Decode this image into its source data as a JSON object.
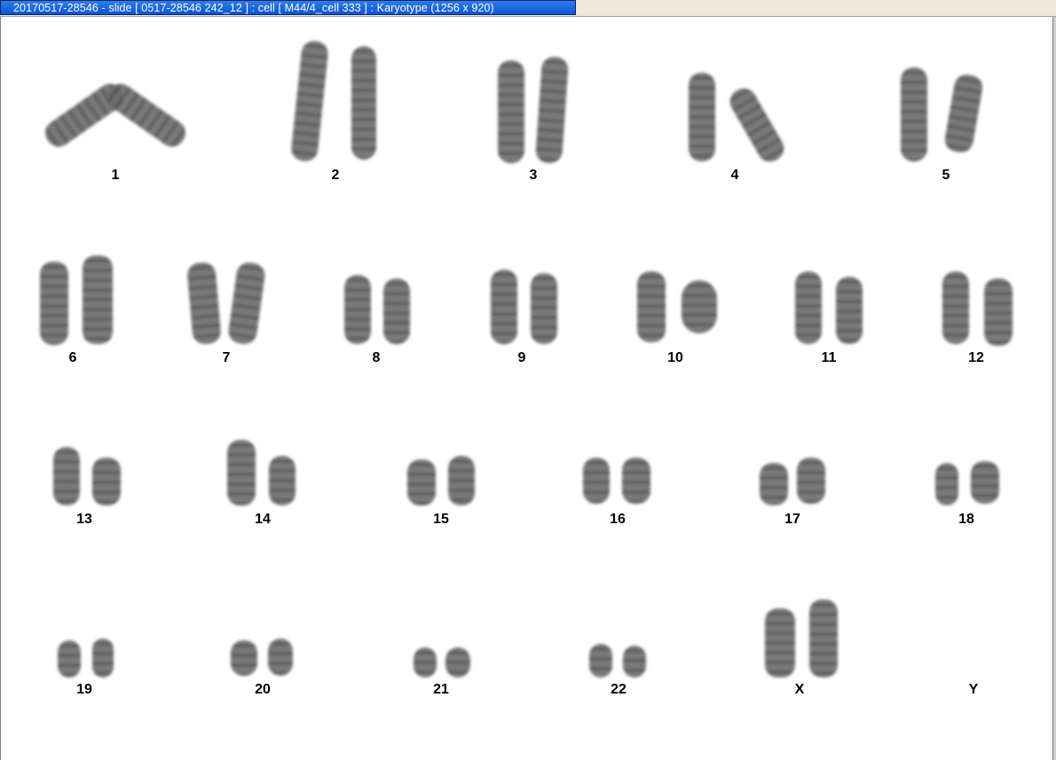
{
  "window": {
    "title": "20170517-28546 - slide [ 0517-28546 242_12 ] : cell [ M44/4_cell 333 ] : Karyotype  (1256 x 920)"
  },
  "karyotype": {
    "labels": [
      "1",
      "2",
      "3",
      "4",
      "5",
      "6",
      "7",
      "8",
      "9",
      "10",
      "11",
      "12",
      "13",
      "14",
      "15",
      "16",
      "17",
      "18",
      "19",
      "20",
      "21",
      "22",
      "X",
      "Y"
    ]
  }
}
